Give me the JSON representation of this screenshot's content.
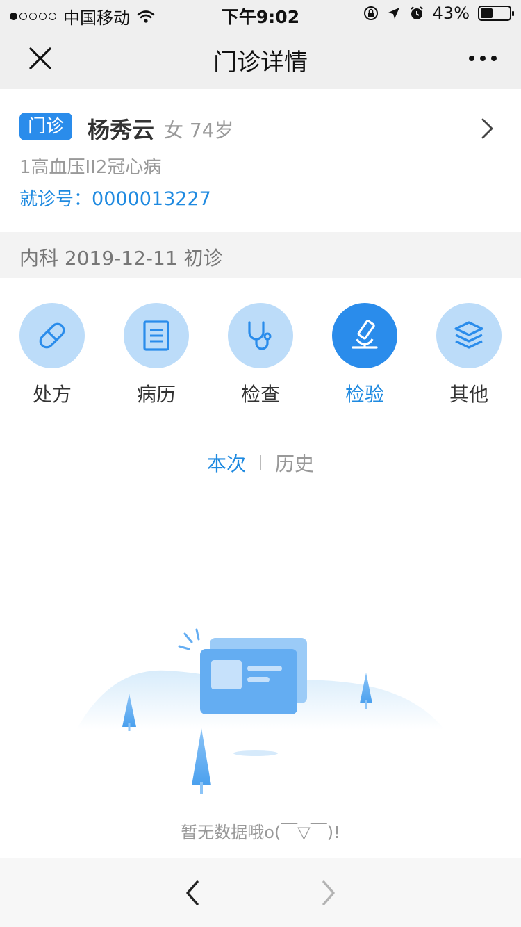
{
  "status_bar": {
    "carrier": "中国移动",
    "time": "下午9:02",
    "battery": "43%",
    "battery_level": 0.43,
    "signal_bars": 1
  },
  "nav": {
    "title": "门诊详情",
    "close_icon": "close-icon",
    "more_icon": "more-icon"
  },
  "patient": {
    "tag": "门诊",
    "name": "杨秀云",
    "meta": "女 74岁",
    "diagnosis": "1高血压II2冠心病",
    "visit_label": "就诊号：",
    "visit_no": "0000013227"
  },
  "dept": {
    "text": "内科 2019-12-11 初诊"
  },
  "tabs": [
    {
      "label": "处方",
      "icon": "pill-icon",
      "active": false
    },
    {
      "label": "病历",
      "icon": "document-icon",
      "active": false
    },
    {
      "label": "检查",
      "icon": "stethoscope-icon",
      "active": false
    },
    {
      "label": "检验",
      "icon": "microscope-icon",
      "active": true
    },
    {
      "label": "其他",
      "icon": "layers-icon",
      "active": false
    }
  ],
  "subtabs": {
    "current": "本次",
    "history": "历史"
  },
  "empty": {
    "text": "暂无数据哦o(￣▽￣)!"
  },
  "colors": {
    "accent": "#2a8ceb",
    "accent_light": "#bcdcf9",
    "text_blue": "#1f8ae0"
  }
}
